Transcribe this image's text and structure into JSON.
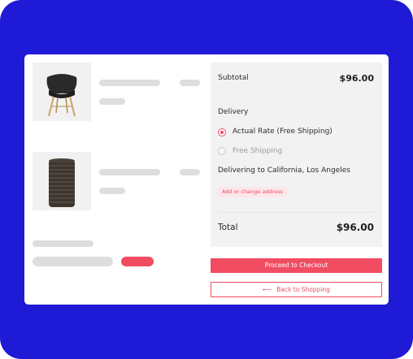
{
  "summary": {
    "subtotal_label": "Subtotal",
    "subtotal_value": "$96.00",
    "delivery_label": "Delivery",
    "options": [
      {
        "label": "Actual Rate (Free Shipping)",
        "selected": true
      },
      {
        "label": "Free Shipping",
        "selected": false
      }
    ],
    "delivering_to": "Delivering to California, Los Angeles",
    "change_address_label": "Add or change address",
    "total_label": "Total",
    "total_value": "$96.00"
  },
  "actions": {
    "checkout_label": "Proceed to Checkout",
    "back_arrow": "⟵",
    "back_label": "Back to Shopping"
  },
  "cart": {
    "items": [
      {
        "image_icon": "chair-icon"
      },
      {
        "image_icon": "vase-icon"
      }
    ]
  },
  "colors": {
    "background": "#1f1ad6",
    "accent": "#f24c62",
    "panel": "#f2f2f2",
    "skeleton": "#dedede"
  }
}
